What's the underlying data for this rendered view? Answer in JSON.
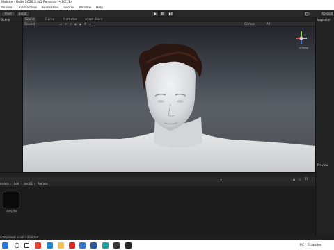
{
  "window": {
    "title": "Malone - Unity 2020.3.4f1 Personal* <DX11>"
  },
  "menu": {
    "items": [
      "Malone",
      "Cinemachine",
      "Realisation",
      "Tutorial",
      "Window",
      "Help"
    ]
  },
  "toolbar": {
    "pivot_label": "Pivot",
    "local_label": "Local",
    "play_icon": "play-icon",
    "pause_icon": "pause-icon",
    "step_icon": "step-icon",
    "cloud_icon": "cloud-icon",
    "account_label": "Account"
  },
  "left_panel": {
    "title": "Scene"
  },
  "right_panel": {
    "inspector_label": "Inspector",
    "preview_label": "Preview"
  },
  "scene_tabs": {
    "scene": "Scene",
    "game": "Game",
    "animator": "Animator",
    "asset_store": "Asset Store"
  },
  "scene_toolbar": {
    "shading_mode": "Shaded",
    "gizmos_label": "Gizmos",
    "search_label": "All"
  },
  "viewport": {
    "gizmo_label": "< Persp",
    "axis_colors": {
      "x": "#e2483b",
      "y": "#8bd23e",
      "z": "#3f78e6"
    }
  },
  "project": {
    "breadcrumb": [
      "Assets",
      "bod",
      "bod01",
      "Prefabs"
    ],
    "assets": [
      {
        "name": "Unity_Bo"
      }
    ],
    "asset_count": "11"
  },
  "status": {
    "message": "component is not initialized"
  },
  "taskbar": {
    "icons": [
      {
        "name": "windows-start-icon",
        "color": "#1f7ae0"
      },
      {
        "name": "search-icon",
        "color": "#333333"
      },
      {
        "name": "task-view-icon",
        "color": "#333333"
      },
      {
        "name": "chrome-icon",
        "color": "#e34133"
      },
      {
        "name": "edge-icon",
        "color": "#1a8ad8"
      },
      {
        "name": "file-explorer-icon",
        "color": "#f2c04a"
      },
      {
        "name": "opera-icon",
        "color": "#e02424"
      },
      {
        "name": "store-icon",
        "color": "#3a77c8"
      },
      {
        "name": "word-icon",
        "color": "#2b579a"
      },
      {
        "name": "rider-icon",
        "color": "#1aa3a3"
      },
      {
        "name": "unity-hub-icon",
        "color": "#333333"
      },
      {
        "name": "unity-icon",
        "color": "#222222"
      }
    ],
    "tray_label": "PC",
    "tray_user": "Eclairdes"
  }
}
